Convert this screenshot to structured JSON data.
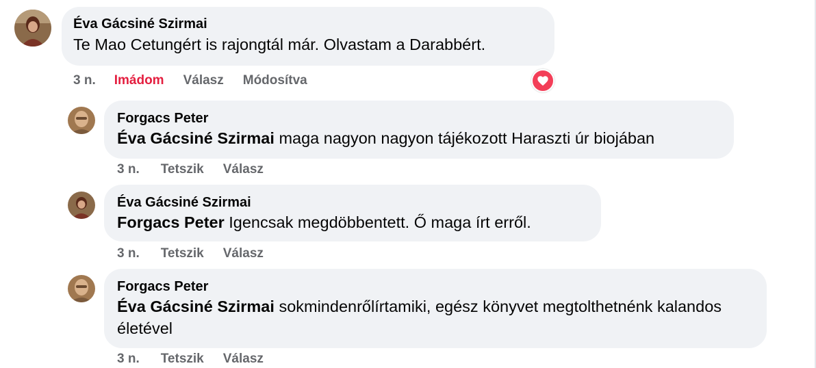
{
  "comments": [
    {
      "author": "Éva Gácsiné Szirmai",
      "mention": "",
      "text": "Te Mao Cetungért is rajongtál már. Olvastam a Darabbért.",
      "time": "3 n.",
      "reaction_label": "Imádom",
      "reply_label": "Válasz",
      "edited_label": "Módosítva",
      "reaction_icon": "heart-icon"
    },
    {
      "author": "Forgacs Peter",
      "mention": "Éva Gácsiné Szirmai",
      "text": "maga nagyon nagyon tájékozott Haraszti úr biojában",
      "time": "3 n.",
      "like_label": "Tetszik",
      "reply_label": "Válasz"
    },
    {
      "author": "Éva Gácsiné Szirmai",
      "mention": "Forgacs Peter",
      "text": "Igencsak megdöbbentett. Ő maga írt erről.",
      "time": "3 n.",
      "like_label": "Tetszik",
      "reply_label": "Válasz"
    },
    {
      "author": "Forgacs Peter",
      "mention": "Éva Gácsiné Szirmai",
      "text": "sokmindenrőlírtamiki, egész könyvet megtolthetnénk kalandos életével",
      "time": "3 n.",
      "like_label": "Tetszik",
      "reply_label": "Válasz"
    }
  ],
  "colors": {
    "bubble": "#f0f2f5",
    "meta": "#65676b",
    "love": "#e41e3f",
    "heart": "#f33e58"
  }
}
